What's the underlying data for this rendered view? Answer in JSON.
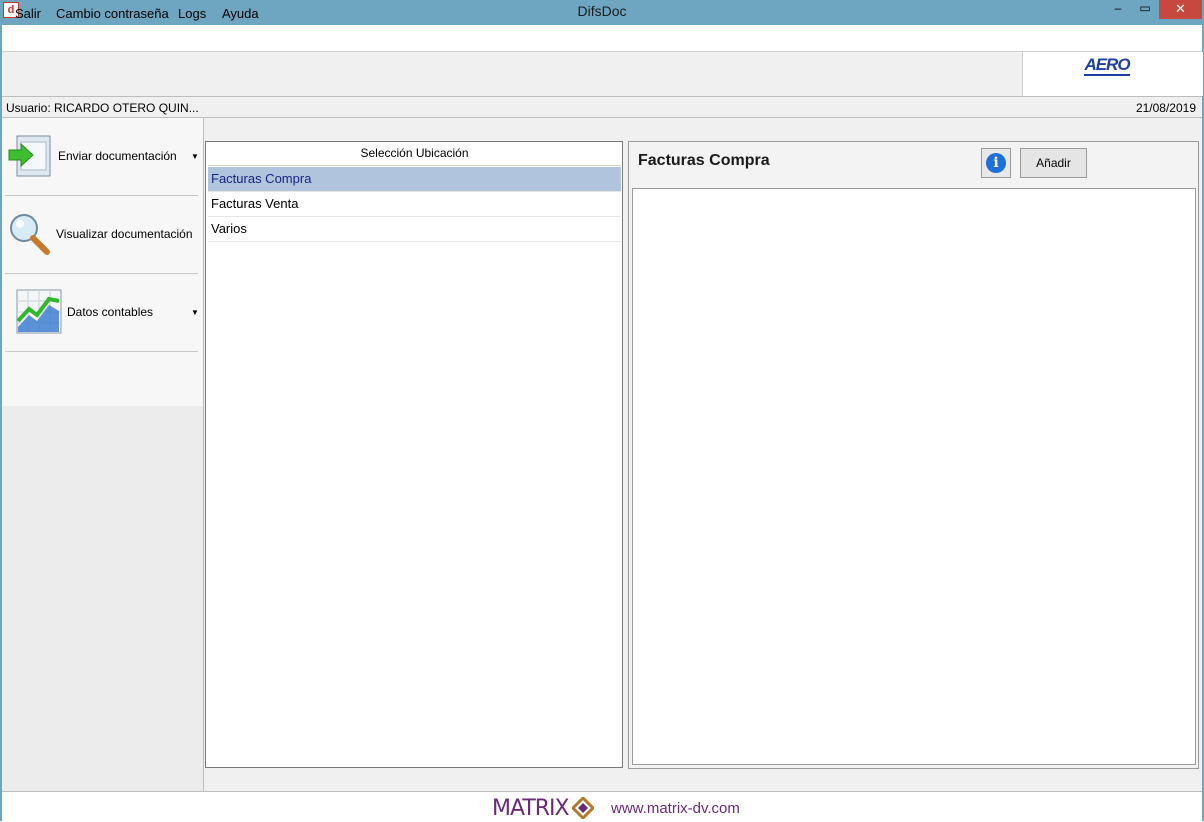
{
  "window": {
    "title": "DifsDoc",
    "minimize": "–",
    "maximize": "▭",
    "close": "✕",
    "app_icon": "d"
  },
  "menu": [
    "Salir",
    "Cambio contraseña",
    "Logs",
    "Ayuda"
  ],
  "logo": {
    "text": "AERO",
    "icon": "aero-logo"
  },
  "status": {
    "user": "Usuario: RICARDO OTERO QUIN...",
    "date": "21/08/2019"
  },
  "nav": [
    {
      "label": "Enviar documentación",
      "icon": "send-document-icon",
      "dropdown": true
    },
    {
      "label": "Visualizar documentación",
      "icon": "magnifier-icon",
      "dropdown": false
    },
    {
      "label": "Datos contables",
      "icon": "chart-icon",
      "dropdown": true
    }
  ],
  "locations": {
    "header": "Selección Ubicación",
    "items": [
      "Facturas Compra",
      "Facturas Venta",
      "Varios"
    ],
    "selected": "Facturas Compra"
  },
  "detail": {
    "title": "Facturas Compra",
    "info_icon": "info-icon",
    "add_label": "Añadir"
  },
  "footer": {
    "brand": "MATRIX",
    "url": "www.matrix-dv.com"
  },
  "colors": {
    "titlebar": "#6ea6c2",
    "close": "#c7483f",
    "selected_row": "#b0c4de",
    "brand": "#6b2a79"
  }
}
